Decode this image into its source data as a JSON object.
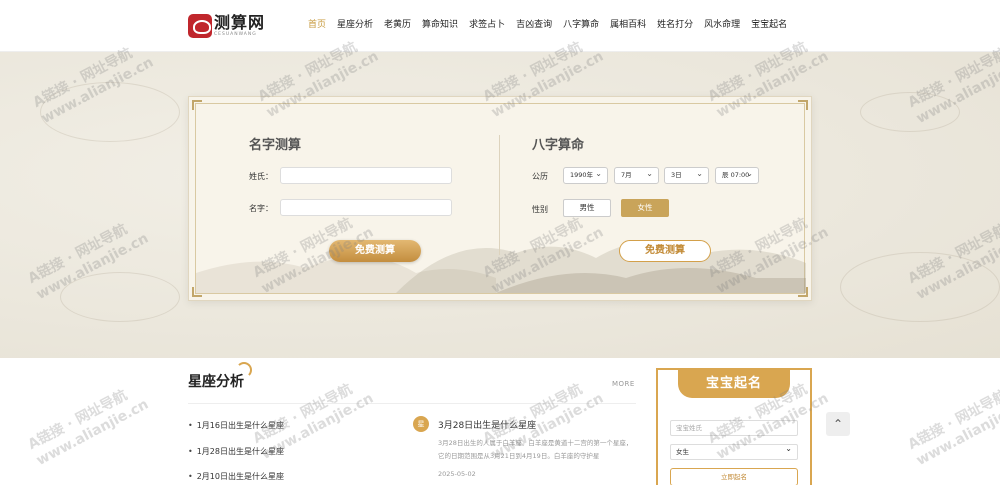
{
  "site": {
    "logo_text": "测算网",
    "logo_sub": "CESUANWANG"
  },
  "nav": [
    "首页",
    "星座分析",
    "老黄历",
    "算命知识",
    "求签占卜",
    "吉凶查询",
    "八字算命",
    "属相百科",
    "姓名打分",
    "风水命理",
    "宝宝起名"
  ],
  "name_test": {
    "title": "名字测算",
    "surname_label": "姓氏：",
    "name_label": "名字：",
    "button": "免费测算"
  },
  "bazi": {
    "title": "八字算命",
    "calendar_label": "公历",
    "year": "1990年",
    "month": "7月",
    "day": "3日",
    "hour": "辰 07:00",
    "gender_label": "性别",
    "male": "男性",
    "female": "女性",
    "button": "免费测算"
  },
  "horoscope": {
    "title": "星座分析",
    "more": "MORE",
    "list": [
      "1月16日出生是什么星座",
      "1月28日出生是什么星座",
      "2月10日出生是什么星座"
    ],
    "featured": {
      "icon_char": "星",
      "title": "3月28日出生是什么星座",
      "desc": "3月28日出生的人属于白羊座。白羊座是黄道十二宫的第一个星座，它的日期范围是从3月21日到4月19日。白羊座的守护星",
      "date": "2025-05-02"
    }
  },
  "baby_name": {
    "title": "宝宝起名",
    "placeholder": "宝宝姓氏",
    "gender": "女生",
    "button": "立即起名"
  },
  "watermark": {
    "line1": "A链接 · 网址导航",
    "line2": "www.alianjie.cn"
  },
  "back_top": "⌃"
}
